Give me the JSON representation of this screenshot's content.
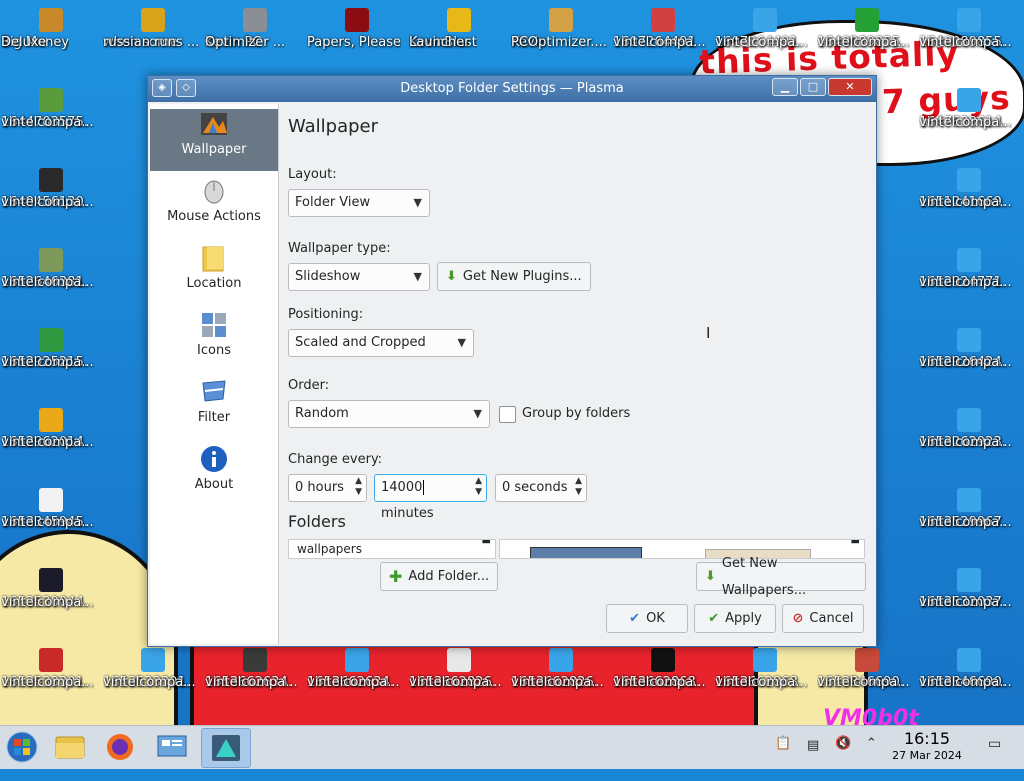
{
  "wallpaper": {
    "bubble_text": "this is totally windows 7 guys",
    "watermark": "VM0b0t"
  },
  "desktop_icons": [
    {
      "name": "Big Money Deluxe",
      "l1": "Big Money",
      "l2": "Deluxe",
      "icon": "money-bag-icon",
      "color": "#c8892a"
    },
    {
      "name": "when some russian runs",
      "l1": "when some",
      "l2": "russian runs ...",
      "icon": "game-icon",
      "color": "#d9a21b"
    },
    {
      "name": "Kevin PC Optimizer",
      "l1": "Kevin PC",
      "l2": "Optimizer ...",
      "icon": "optimizer-icon",
      "color": "#8b8f95"
    },
    {
      "name": "Papers, Please",
      "l1": "Papers, Please",
      "l2": "",
      "icon": "papers-please-icon",
      "color": "#8b0d12"
    },
    {
      "name": "KevinBlast Launcher",
      "l1": "KevinBlast",
      "l2": "Launcher",
      "icon": "launcher-icon",
      "color": "#e8b818"
    },
    {
      "name": "Kevin PCOptimizer",
      "l1": "Kevin",
      "l2": "PCOptimizer....",
      "icon": "optimizer-icon",
      "color": "#d3a046"
    },
    {
      "name": "1607264491 vintelcompa",
      "l1": "1607264491",
      "l2": "vintelcompa...",
      "icon": "url-icon",
      "color": "#d24141"
    },
    {
      "name": "1607264491 vintelcompa 2",
      "l1": "1607264491.",
      "l2": "vintelcompa...",
      "icon": "url-icon",
      "color": "#3aa4e8"
    },
    {
      "name": "1640089855 vintelcompa",
      "l1": "1640089855.",
      "l2": "vintelcompa...",
      "icon": "url-icon",
      "color": "#25a035"
    },
    {
      "name": "1640089855 vintelcompa 2",
      "l1": "1640089855.",
      "l2": "vintelcompa...",
      "icon": "url-icon",
      "color": "#3aa4e8"
    },
    {
      "name": "1644703575 vintelcompa",
      "l1": "1644703575.",
      "l2": "vintelcompa...",
      "icon": "url-icon",
      "color": "#5a9b3c"
    },
    {
      "name": "1647638614 vintelcompa",
      "l1": "1647638614.",
      "l2": "vintelcompa...",
      "icon": "url-icon",
      "color": "#3aa4e8"
    },
    {
      "name": "1649456130 vintelcompa",
      "l1": "1649456130.",
      "l2": "vintelcompa...",
      "icon": "url-icon",
      "color": "#2a2a2a"
    },
    {
      "name": "1651241669 vintelcompa",
      "l1": "1651241669.",
      "l2": "vintelcompa...",
      "icon": "url-icon",
      "color": "#3aa4e8"
    },
    {
      "name": "1652646381 vintelcompa",
      "l1": "1652646381.",
      "l2": "vintelcompa...",
      "icon": "url-icon",
      "color": "#7d9a5a"
    },
    {
      "name": "1652924771 vintelcompa",
      "l1": "1652924771.",
      "l2": "vintelcompa...",
      "icon": "url-icon",
      "color": "#3aa4e8"
    },
    {
      "name": "1652925215 vintelcompa",
      "l1": "1652925215.",
      "l2": "vintelcompa...",
      "icon": "url-icon",
      "color": "#2f9a3f"
    },
    {
      "name": "1652926424 vintelcompa",
      "l1": "1652926424.",
      "l2": "vintelcompa...",
      "icon": "url-icon",
      "color": "#3aa4e8"
    },
    {
      "name": "1652962014 vintelcompa",
      "l1": "1652962014.",
      "l2": "vintelcompa...",
      "icon": "url-icon",
      "color": "#e8a818"
    },
    {
      "name": "1653262923 vintelcompa",
      "l1": "1653262923.",
      "l2": "vintelcompa...",
      "icon": "url-icon",
      "color": "#3aa4e8"
    },
    {
      "name": "1653345945 vintelcompa",
      "l1": "1653345945.",
      "l2": "vintelcompa...",
      "icon": "mp4-file-icon",
      "color": "#f2f2f2"
    },
    {
      "name": "1653529967 vintelcompa",
      "l1": "1653529967.",
      "l2": "vintelcompa...",
      "icon": "url-icon",
      "color": "#3aa4e8"
    },
    {
      "name": "1653530044 vintelcompa",
      "l1": "1653530044.",
      "l2": "vintelcompa...",
      "icon": "url-icon",
      "color": "#1a1a2a"
    },
    {
      "name": "1653532037 vintelcompa",
      "l1": "1653532037.",
      "l2": "vintelcompa...",
      "icon": "url-icon",
      "color": "#3aa4e8"
    },
    {
      "name": "1653533301 vintelcompa",
      "l1": "1653533301.",
      "l2": "vintelcompa...",
      "icon": "url-icon",
      "color": "#c82a2a"
    },
    {
      "name": "1653533301 vintelcompa 2",
      "l1": "1653533301.",
      "l2": "vintelcompa...",
      "icon": "url-icon",
      "color": "#3aa4e8"
    },
    {
      "name": "1653662634 vintelcompa",
      "l1": "1653662634.",
      "l2": "vintelcompa...",
      "icon": "url-icon",
      "color": "#3a3a3a"
    },
    {
      "name": "1653662634 vintelcompa 2",
      "l1": "1653662634.",
      "l2": "vintelcompa...",
      "icon": "url-icon",
      "color": "#3aa4e8"
    },
    {
      "name": "1653662826 vintelcompa",
      "l1": "1653662826.",
      "l2": "vintelcompa...",
      "icon": "url-icon",
      "color": "#e8e8e8"
    },
    {
      "name": "1653662826 vintelcompa 2",
      "l1": "1653662826.",
      "l2": "vintelcompa...",
      "icon": "url-icon",
      "color": "#3aa4e8"
    },
    {
      "name": "1653662868 vintelcompa",
      "l1": "1653662868.",
      "l2": "vintelcompa...",
      "icon": "url-icon",
      "color": "#111111"
    },
    {
      "name": "1653662868 vintelcompa 2",
      "l1": "1653662868.",
      "l2": "vintelcompa...",
      "icon": "url-icon",
      "color": "#3aa4e8"
    },
    {
      "name": "1653846690 vintelcompa",
      "l1": "1653846690.",
      "l2": "vintelcompa...",
      "icon": "url-icon",
      "color": "#c84a3a"
    },
    {
      "name": "1653846690 vintelcompa 2",
      "l1": "1653846690.",
      "l2": "vintelcompa...",
      "icon": "url-icon",
      "color": "#3aa4e8"
    }
  ],
  "dialog": {
    "title": "Desktop Folder Settings — Plasma",
    "sidebar": [
      {
        "label": "Wallpaper",
        "icon": "wallpaper-icon",
        "active": true
      },
      {
        "label": "Mouse Actions",
        "icon": "mouse-icon",
        "active": false
      },
      {
        "label": "Location",
        "icon": "folder-icon",
        "active": false
      },
      {
        "label": "Icons",
        "icon": "icons-icon",
        "active": false
      },
      {
        "label": "Filter",
        "icon": "filter-icon",
        "active": false
      },
      {
        "label": "About",
        "icon": "info-icon",
        "active": false
      }
    ],
    "heading": "Wallpaper",
    "layout_label": "Layout:",
    "layout_value": "Folder View",
    "wallpaper_type_label": "Wallpaper type:",
    "wallpaper_type_value": "Slideshow",
    "get_new_plugins": "Get New Plugins...",
    "positioning_label": "Positioning:",
    "positioning_value": "Scaled and Cropped",
    "order_label": "Order:",
    "order_value": "Random",
    "group_by_folders": "Group by folders",
    "change_every_label": "Change every:",
    "hours_value": "0 hours",
    "minutes_number": "14000",
    "minutes_unit": " minutes",
    "seconds_value": "0 seconds",
    "folders_heading": "Folders",
    "folder_item": "wallpapers",
    "add_folder": "Add Folder...",
    "get_new_wallpapers": "Get New Wallpapers...",
    "ok": "OK",
    "apply": "Apply",
    "cancel": "Cancel"
  },
  "taskbar": {
    "time": "16:15",
    "date": "27 Mar 2024",
    "apps": [
      "start-orb-icon",
      "file-manager-icon",
      "firefox-icon",
      "system-settings-icon",
      "plasma-settings-icon"
    ]
  }
}
